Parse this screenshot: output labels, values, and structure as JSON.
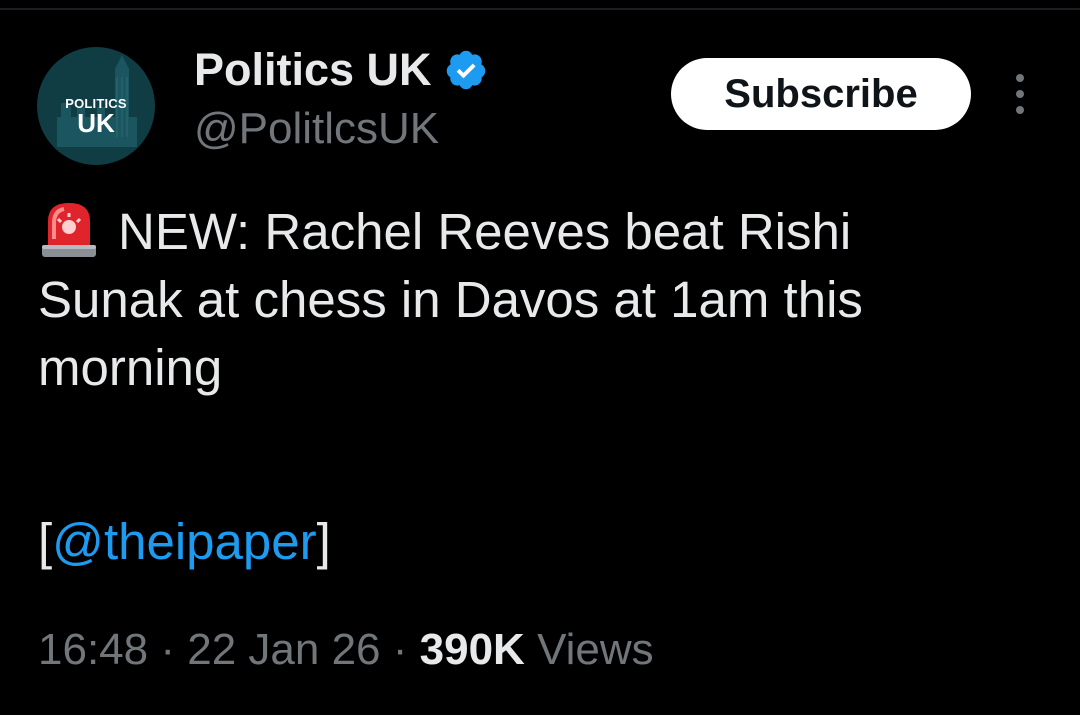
{
  "account": {
    "display_name": "Politics UK",
    "handle": "@PolitlcsUK",
    "verified": true,
    "avatar": {
      "line1": "POLITICS",
      "line2": "UK",
      "background": "#103c44"
    }
  },
  "actions": {
    "subscribe_label": "Subscribe"
  },
  "tweet": {
    "icon": "police-siren-icon",
    "lines": [
      "NEW: Rachel Reeves beat Rishi",
      "Sunak at chess in Davos at 1am this",
      "morning"
    ],
    "link_prefix": "[",
    "mention": "@theipaper",
    "link_suffix": "]"
  },
  "meta": {
    "time": "16:48",
    "separator": "·",
    "date": "22 Jan 26",
    "views_count": "390K",
    "views_label": "Views"
  },
  "colors": {
    "background": "#000000",
    "text": "#e7e9ea",
    "secondary_text": "#71767b",
    "link": "#1d9bf0",
    "verified": "#1d9bf0"
  }
}
